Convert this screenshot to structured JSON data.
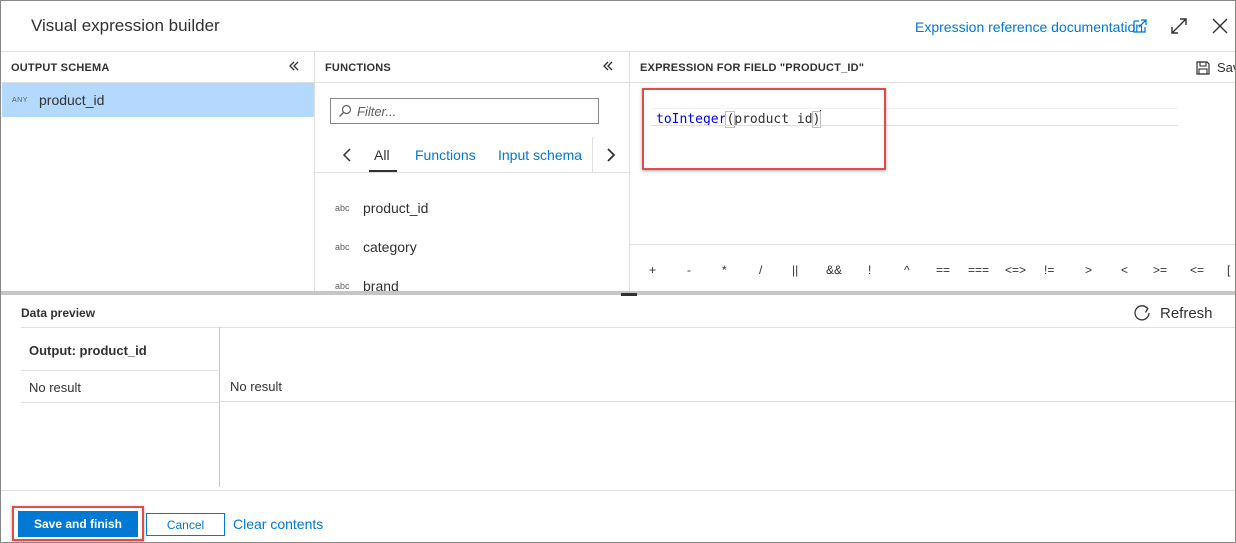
{
  "header": {
    "title": "Visual expression builder",
    "doc_link": "Expression reference documentation"
  },
  "output_schema": {
    "header": "OUTPUT SCHEMA",
    "items": [
      {
        "type": "ANY",
        "name": "product_id",
        "selected": true
      }
    ]
  },
  "functions": {
    "header": "FUNCTIONS",
    "filter_placeholder": "Filter...",
    "tabs": [
      {
        "label": "All",
        "active": true
      },
      {
        "label": "Functions",
        "active": false
      },
      {
        "label": "Input schema",
        "active": false
      }
    ],
    "items": [
      {
        "type": "abc",
        "name": "product_id"
      },
      {
        "type": "abc",
        "name": "category"
      },
      {
        "type": "abc",
        "name": "brand"
      }
    ]
  },
  "expression": {
    "header": "EXPRESSION FOR FIELD \"PRODUCT_ID\"",
    "save_label": "Save",
    "code_function": "toInteger",
    "code_open": "(",
    "code_arg": "product_id",
    "code_close": ")",
    "operators": [
      "+",
      "-",
      "*",
      "/",
      "||",
      "&&",
      "!",
      "^",
      "==",
      "===",
      "<=>",
      "!=",
      ">",
      "<",
      ">=",
      "<=",
      "["
    ]
  },
  "data_preview": {
    "title": "Data preview",
    "refresh_label": "Refresh",
    "column_header": "Output: product_id",
    "row_value_1": "No result",
    "row_value_2": "No result"
  },
  "footer": {
    "save_finish": "Save and finish",
    "cancel": "Cancel",
    "clear": "Clear contents"
  },
  "colors": {
    "accent": "#0078d4",
    "selected_row": "#b3d9ff",
    "highlight_box": "#e04b4b"
  }
}
